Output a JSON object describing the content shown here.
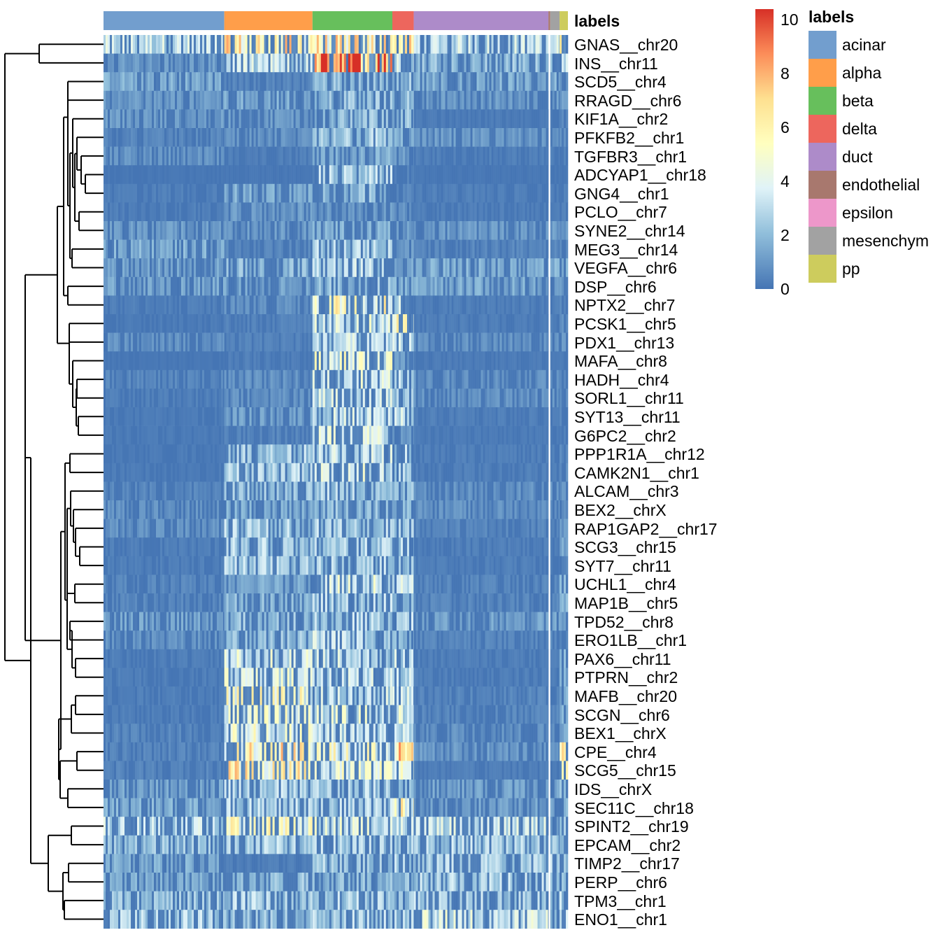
{
  "chart_data": {
    "type": "heatmap",
    "title": "",
    "annotation_title": "labels",
    "color_scale": {
      "min": 0,
      "max": 10.4,
      "ticks": [
        "0",
        "2",
        "4",
        "6",
        "8",
        "10"
      ],
      "tick_values": [
        0,
        2,
        4,
        6,
        8,
        10
      ],
      "palette": [
        "#4575b4",
        "#91bfdb",
        "#e0f3f8",
        "#ffffbf",
        "#fee090",
        "#fc8d59",
        "#d73027"
      ]
    },
    "cell_types": [
      {
        "name": "acinar",
        "color": "#729ECE",
        "fraction": 0.26
      },
      {
        "name": "alpha",
        "color": "#FF9E4A",
        "fraction": 0.19
      },
      {
        "name": "beta",
        "color": "#67BF5C",
        "fraction": 0.172
      },
      {
        "name": "delta",
        "color": "#ED665D",
        "fraction": 0.046
      },
      {
        "name": "duct",
        "color": "#AD8BC9",
        "fraction": 0.29
      },
      {
        "name": "endothelial",
        "color": "#A8786E",
        "fraction": 0.004
      },
      {
        "name": "epsilon",
        "color": "#ED97CA",
        "fraction": 0.0
      },
      {
        "name": "mesenchymal",
        "color": "#A2A2A2",
        "fraction": 0.02
      },
      {
        "name": "pp",
        "color": "#CDCC5D",
        "fraction": 0.018
      }
    ],
    "legend_labels": [
      "acinar",
      "alpha",
      "beta",
      "delta",
      "duct",
      "endothelial",
      "epsilon",
      "mesenchym",
      "pp"
    ],
    "genes": [
      "GNAS__chr20",
      "INS__chr11",
      "SCD5__chr4",
      "RRAGD__chr6",
      "KIF1A__chr2",
      "PFKFB2__chr1",
      "TGFBR3__chr1",
      "ADCYAP1__chr18",
      "GNG4__chr1",
      "PCLO__chr7",
      "SYNE2__chr14",
      "MEG3__chr14",
      "VEGFA__chr6",
      "DSP__chr6",
      "NPTX2__chr7",
      "PCSK1__chr5",
      "PDX1__chr13",
      "MAFA__chr8",
      "HADH__chr4",
      "SORL1__chr11",
      "SYT13__chr11",
      "G6PC2__chr2",
      "PPP1R1A__chr12",
      "CAMK2N1__chr1",
      "ALCAM__chr3",
      "BEX2__chrX",
      "RAP1GAP2__chr17",
      "SCG3__chr15",
      "SYT7__chr11",
      "UCHL1__chr4",
      "MAP1B__chr5",
      "TPD52__chr8",
      "ERO1LB__chr1",
      "PAX6__chr11",
      "PTPRN__chr2",
      "MAFB__chr20",
      "SCGN__chr6",
      "BEX1__chrX",
      "CPE__chr4",
      "SCG5__chr15",
      "IDS__chrX",
      "SEC11C__chr18",
      "SPINT2__chr19",
      "EPCAM__chr2",
      "TIMP2__chr17",
      "PERP__chr6",
      "TPM3__chr1",
      "ENO1__chr1"
    ],
    "mean_expression_by_type_columns": [
      "acinar",
      "alpha",
      "beta",
      "delta",
      "duct",
      "mesenchymal",
      "pp"
    ],
    "mean_expression_by_type": [
      [
        3,
        5.5,
        5.5,
        5.5,
        3,
        3,
        5.5
      ],
      [
        1,
        3,
        9,
        3,
        2,
        2,
        3
      ],
      [
        1.5,
        0.5,
        2,
        2,
        1.5,
        1.5,
        1
      ],
      [
        1,
        1.5,
        2,
        2,
        1,
        1,
        1
      ],
      [
        1,
        1,
        2,
        2,
        0.2,
        0.2,
        0.5
      ],
      [
        0.5,
        0.8,
        2.5,
        1.5,
        1,
        1,
        1
      ],
      [
        0.8,
        0.3,
        1.5,
        1,
        0.3,
        0.3,
        0.3
      ],
      [
        0.1,
        0.1,
        2.5,
        0.5,
        0.1,
        0.1,
        0.1
      ],
      [
        0.3,
        1.5,
        2,
        0.5,
        0.3,
        0.3,
        0.3
      ],
      [
        0.3,
        1,
        1,
        0.8,
        0.3,
        0.3,
        0.3
      ],
      [
        1,
        1,
        1.5,
        1,
        1,
        1,
        1
      ],
      [
        1.5,
        0.5,
        2.5,
        1,
        0.5,
        0.5,
        0.5
      ],
      [
        1.2,
        1.8,
        2.8,
        1.5,
        1.5,
        1.5,
        1.5
      ],
      [
        1.3,
        1.2,
        2,
        1.5,
        1.4,
        1.4,
        1.4
      ],
      [
        0.3,
        0.8,
        5,
        3,
        0.3,
        0.3,
        0.5
      ],
      [
        0.2,
        0.4,
        3.5,
        5,
        0.3,
        0.3,
        0.8
      ],
      [
        0.8,
        0.4,
        3,
        3,
        0.8,
        0.8,
        0.8
      ],
      [
        0.1,
        0.3,
        4,
        1,
        0.2,
        0.2,
        0.3
      ],
      [
        0.5,
        0.8,
        3.5,
        3,
        0.8,
        0.8,
        0.8
      ],
      [
        0.3,
        0.8,
        3,
        2,
        0.8,
        0.8,
        0.8
      ],
      [
        0.2,
        1.2,
        3,
        3,
        0.3,
        0.3,
        0.5
      ],
      [
        0.2,
        0.5,
        3.5,
        1,
        0.2,
        0.2,
        0.3
      ],
      [
        0.2,
        2.5,
        3,
        2.5,
        0.3,
        0.3,
        0.5
      ],
      [
        0.2,
        2.5,
        3.5,
        2.5,
        0.3,
        0.3,
        0.8
      ],
      [
        0.5,
        2,
        2.5,
        2,
        0.8,
        0.8,
        0.8
      ],
      [
        0.8,
        1.5,
        2,
        1.8,
        0.8,
        0.8,
        0.8
      ],
      [
        0.8,
        2.5,
        2.5,
        2.5,
        0.5,
        0.5,
        1
      ],
      [
        0.3,
        2.5,
        2.5,
        2.5,
        0.3,
        0.3,
        1.5
      ],
      [
        0.3,
        2.5,
        2.5,
        2,
        0.3,
        0.3,
        0.5
      ],
      [
        0.5,
        1.5,
        3.5,
        3,
        0.5,
        0.5,
        1.5
      ],
      [
        0.5,
        1.8,
        2.5,
        2.5,
        0.5,
        0.5,
        1.5
      ],
      [
        1.2,
        2,
        2.5,
        2.5,
        1.2,
        1.2,
        1.2
      ],
      [
        0.8,
        2.2,
        3,
        2,
        0.5,
        0.5,
        0.5
      ],
      [
        0.3,
        3.5,
        3,
        3,
        0.3,
        0.3,
        1.5
      ],
      [
        0.3,
        3.5,
        3,
        3,
        0.3,
        0.3,
        1.5
      ],
      [
        0.3,
        4.5,
        3,
        3,
        0.5,
        0.5,
        1.5
      ],
      [
        0.3,
        4,
        3.5,
        3.5,
        0.5,
        0.5,
        1.5
      ],
      [
        0.5,
        4,
        3,
        3,
        0.8,
        0.8,
        1.5
      ],
      [
        0.5,
        5.5,
        4.5,
        6,
        1,
        1,
        5
      ],
      [
        0.5,
        5.5,
        4,
        4,
        0.3,
        0.3,
        5
      ],
      [
        1.2,
        2.5,
        2.5,
        2,
        1.2,
        1.2,
        2
      ],
      [
        1.5,
        2.5,
        2.5,
        5,
        1.2,
        1.2,
        2
      ],
      [
        3,
        4.5,
        3.5,
        3,
        3,
        1,
        3
      ],
      [
        2,
        2.5,
        2.5,
        2.5,
        2.5,
        2,
        2.5
      ],
      [
        1.5,
        0.3,
        2.5,
        2.5,
        2.5,
        2.5,
        2.5
      ],
      [
        1.5,
        2,
        2,
        2,
        2.5,
        2,
        2
      ],
      [
        2,
        2.5,
        2.5,
        2,
        2.5,
        2,
        2.5
      ],
      [
        2.5,
        2,
        2.5,
        2.5,
        3.5,
        2,
        3
      ]
    ],
    "row_dendrogram": true,
    "column_dendrogram": false,
    "legend_position": "right"
  }
}
